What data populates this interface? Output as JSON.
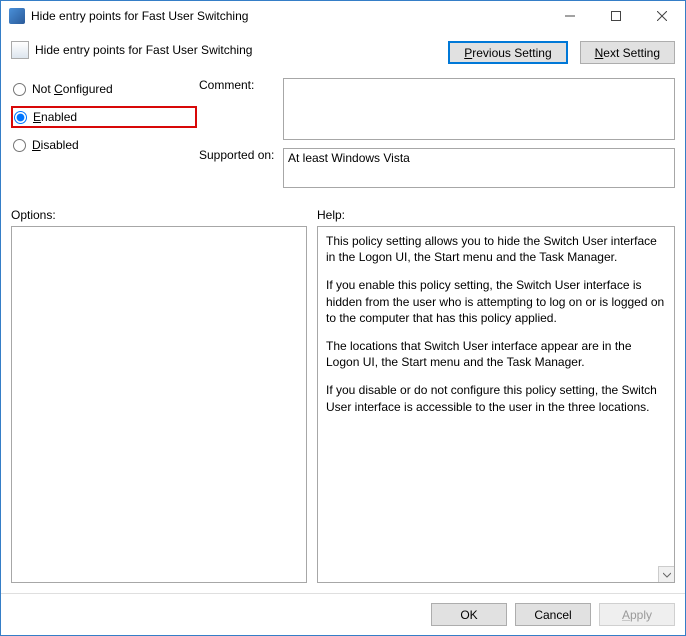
{
  "title": "Hide entry points for Fast User Switching",
  "policy_title": "Hide entry points for Fast User Switching",
  "nav": {
    "prev": "Previous Setting",
    "next": "Next Setting"
  },
  "radios": {
    "not_configured": "Not Configured",
    "enabled": "Enabled",
    "disabled": "Disabled",
    "selected": "enabled"
  },
  "fields": {
    "comment_label": "Comment:",
    "comment_value": "",
    "supported_label": "Supported on:",
    "supported_value": "At least Windows Vista"
  },
  "sections": {
    "options": "Options:",
    "help": "Help:"
  },
  "help_paragraphs": [
    "This policy setting allows you to hide the Switch User interface in the Logon UI, the Start menu and the Task Manager.",
    "If you enable this policy setting, the Switch User interface is hidden from the user who is attempting to log on or is logged on to the computer that has this policy applied.",
    "The locations that Switch User interface appear are in the Logon UI, the Start menu and the Task Manager.",
    "If you disable or do not configure this policy setting, the Switch User interface is accessible to the user in the three locations."
  ],
  "footer": {
    "ok": "OK",
    "cancel": "Cancel",
    "apply": "Apply"
  }
}
